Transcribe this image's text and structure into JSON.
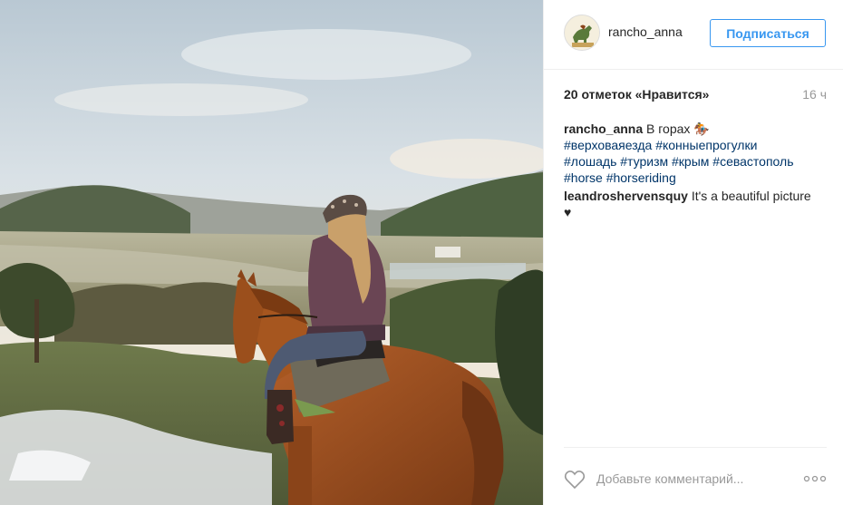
{
  "post": {
    "image_alt": "Woman riding a horse overlooking a valley in the mountains",
    "author": {
      "username": "rancho_anna",
      "follow_label": "Подписаться"
    },
    "likes_text": "20 отметок «Нравится»",
    "time_text": "16 ч",
    "caption": {
      "username": "rancho_anna",
      "text": "В горах",
      "emoji": "🏇",
      "hashtags_line1": "#верховаяезда #конныепрогулки",
      "hashtags_line2": "#лошадь #туризм #крым #севастополь",
      "hashtags_line3": "#horse #horseriding"
    },
    "comments": [
      {
        "username": "leandroshervensquy",
        "text": "It's a beautiful picture",
        "emoji": "♥"
      }
    ],
    "comment_placeholder": "Добавьте комментарий...",
    "colors": {
      "accent": "#3897f0",
      "hashtag": "#003569",
      "muted": "#999999",
      "text": "#262626",
      "border": "#efefef"
    },
    "icons": [
      "heart-icon",
      "more-options-icon",
      "avatar-horse-logo"
    ]
  }
}
